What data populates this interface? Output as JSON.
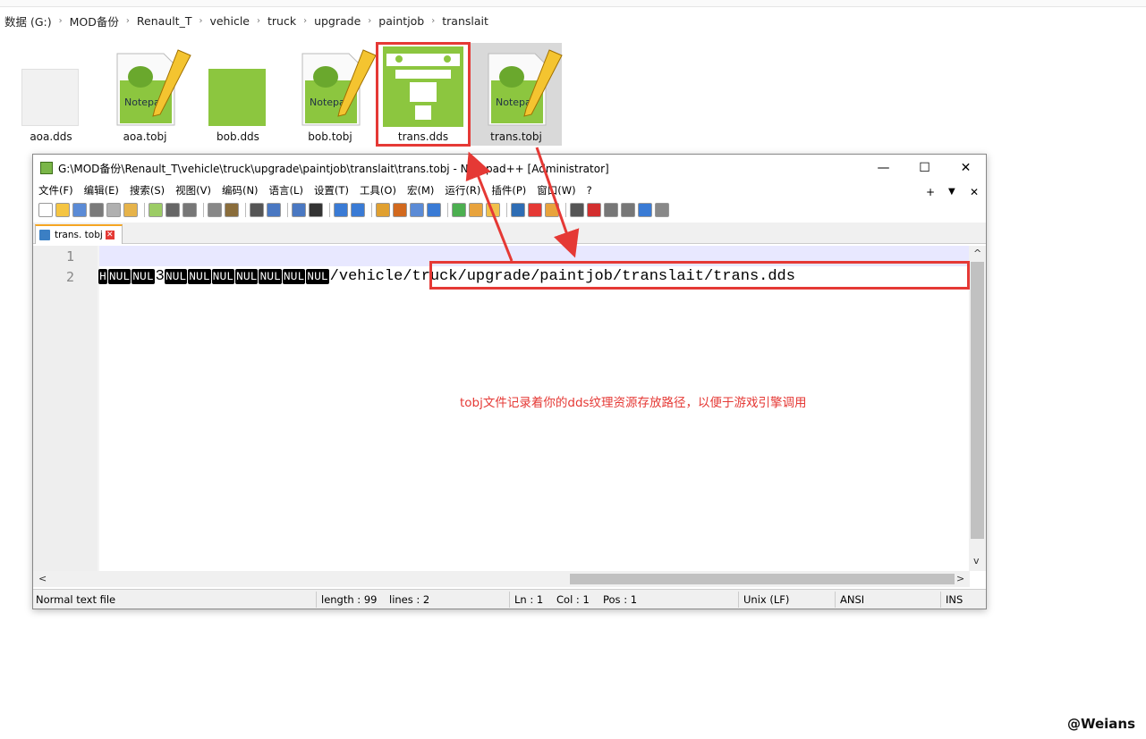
{
  "breadcrumb": [
    "数据 (G:)",
    "MOD备份",
    "Renault_T",
    "vehicle",
    "truck",
    "upgrade",
    "paintjob",
    "translait"
  ],
  "files": [
    {
      "name": "aoa.dds",
      "icon": "blank-image-icon"
    },
    {
      "name": "aoa.tobj",
      "icon": "notepad-plus-plus-icon"
    },
    {
      "name": "bob.dds",
      "icon": "green-texture-icon"
    },
    {
      "name": "bob.tobj",
      "icon": "notepad-plus-plus-icon"
    },
    {
      "name": "trans.dds",
      "icon": "texture-preview-icon"
    },
    {
      "name": "trans.tobj",
      "icon": "notepad-plus-plus-icon"
    }
  ],
  "window": {
    "title": "G:\\MOD备份\\Renault_T\\vehicle\\truck\\upgrade\\paintjob\\translait\\trans.tobj - Notepad++ [Administrator]",
    "minimize": "—",
    "maximize": "☐",
    "close": "✕"
  },
  "menu": [
    "文件(F)",
    "编辑(E)",
    "搜索(S)",
    "视图(V)",
    "编码(N)",
    "语言(L)",
    "设置(T)",
    "工具(O)",
    "宏(M)",
    "运行(R)",
    "插件(P)",
    "窗口(W)",
    "?"
  ],
  "menu_right": {
    "plus": "+",
    "down": "▼",
    "close": "✕"
  },
  "tab": {
    "label": "trans. tobj",
    "close": "✕"
  },
  "editor": {
    "line_numbers": [
      "1",
      "2"
    ],
    "line2_controls": [
      "H",
      "NUL",
      "NUL",
      "3",
      "NUL",
      "NUL",
      "NUL",
      "NUL",
      "NUL",
      "NUL",
      "NUL"
    ],
    "line2_text": "/vehicle/truck/upgrade/paintjob/translait/trans.dds"
  },
  "annotation": "tobj文件记录着你的dds纹理资源存放路径，以便于游戏引擎调用",
  "status": {
    "type": "Normal text file",
    "length": "length : 99",
    "lines": "lines : 2",
    "ln": "Ln : 1",
    "col": "Col : 1",
    "pos": "Pos : 1",
    "eol": "Unix (LF)",
    "encoding": "ANSI",
    "mode": "INS"
  },
  "scroll": {
    "up": "^",
    "down": "v",
    "left": "<",
    "right": ">"
  },
  "watermark": "@Weians",
  "colors": {
    "highlight": "#e53935",
    "accent": "#8cc63f"
  }
}
